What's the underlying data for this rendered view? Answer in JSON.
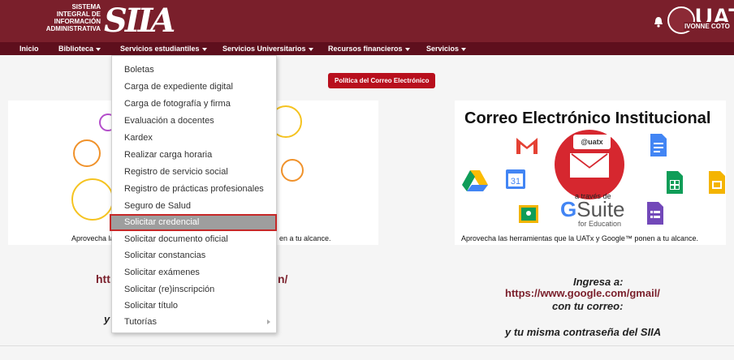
{
  "header": {
    "siia_small_lines": [
      "SISTEMA",
      "INTEGRAL DE",
      "INFORMACIÓN",
      "ADMINISTRATIVA"
    ],
    "siia_logo": "SIIA",
    "uat_logo": "UAT",
    "user_name": "IVONNE COTO"
  },
  "nav": {
    "items": [
      {
        "label": "Inicio",
        "has_caret": false
      },
      {
        "label": "Biblioteca",
        "has_caret": true
      },
      {
        "label": "Servicios estudiantiles",
        "has_caret": true
      },
      {
        "label": "Servicios Universitarios",
        "has_caret": true
      },
      {
        "label": "Recursos financieros",
        "has_caret": true
      },
      {
        "label": "Servicios",
        "has_caret": true
      }
    ]
  },
  "policy_button": "Política del Correo Electrónico",
  "left_panel": {
    "caption_start": "Aprovecha las",
    "caption_end": "en a tu alcance."
  },
  "right_panel": {
    "title": "Correo Electrónico Institucional",
    "uatx_tag": "@uatx",
    "via": "a través de",
    "gsuite_g": "G",
    "gsuite_word": "Suite",
    "for_education": "for Education",
    "caption": "Aprovecha las herramientas que la UATx y Google™ ponen a tu alcance."
  },
  "lower_left": {
    "link_fragment_a": "htt",
    "link_fragment_b": "n/",
    "letter": "y"
  },
  "lower_right": {
    "line1": "Ingresa a:",
    "link": "https://www.google.com/gmail/",
    "line3": "con tu correo:",
    "line4": "y tu misma contraseña del SIIA"
  },
  "dropdown": {
    "items": [
      {
        "label": "Boletas"
      },
      {
        "label": "Carga de expediente digital"
      },
      {
        "label": "Carga de fotografía y firma"
      },
      {
        "label": "Evaluación a docentes"
      },
      {
        "label": "Kardex"
      },
      {
        "label": "Realizar carga horaria"
      },
      {
        "label": "Registro de servicio social"
      },
      {
        "label": "Registro de prácticas profesionales"
      },
      {
        "label": "Seguro de Salud"
      },
      {
        "label": "Solicitar credencial",
        "active": true
      },
      {
        "label": "Solicitar documento oficial"
      },
      {
        "label": "Solicitar constancias"
      },
      {
        "label": "Solicitar exámenes"
      },
      {
        "label": "Solicitar (re)inscripción"
      },
      {
        "label": "Solicitar título"
      },
      {
        "label": "Tutorías",
        "submenu": true
      }
    ]
  },
  "colors": {
    "header_bg": "#7a1f2b",
    "nav_bg": "#5e0f1d",
    "policy_btn": "#b80f1d",
    "active_item_bg": "#9e9e9e",
    "active_item_border": "#c62828"
  }
}
